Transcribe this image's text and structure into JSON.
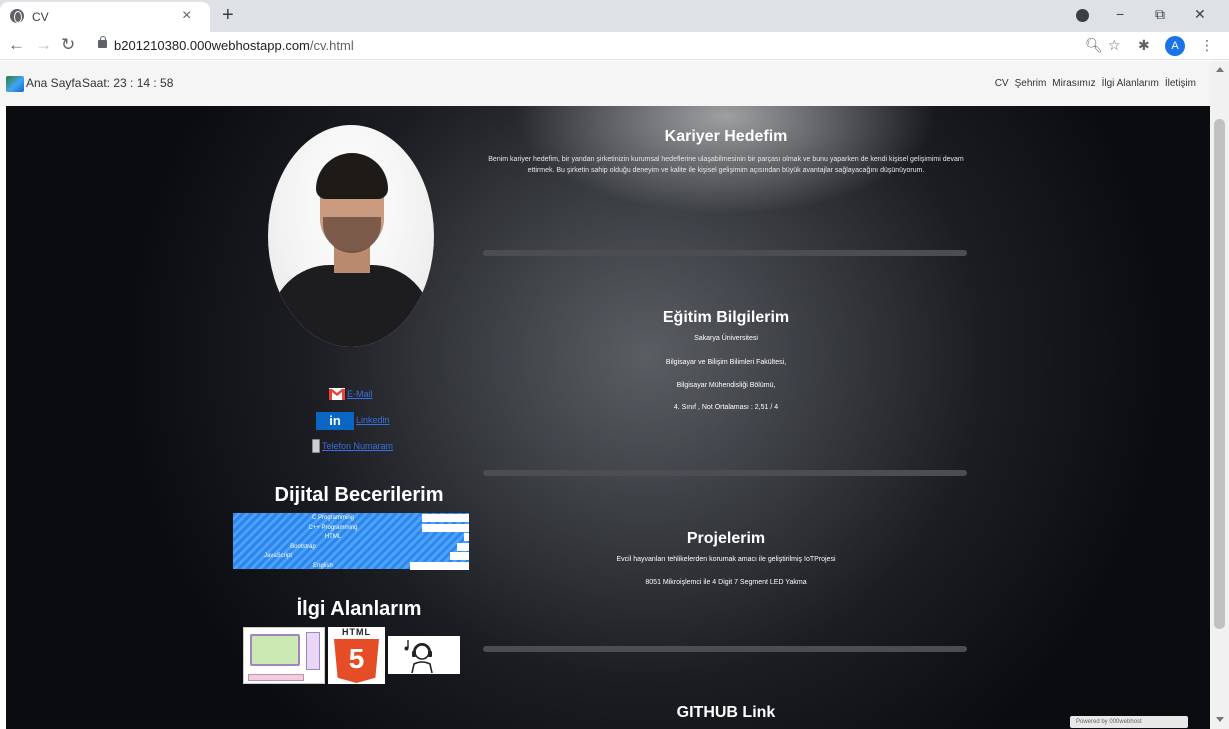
{
  "browser": {
    "tab_title": "CV",
    "new_tab": "+",
    "url_domain": "b201210380.000webhostapp.com",
    "url_path": "/cv.html",
    "profile_initial": "A",
    "controls": {
      "minimize": "−",
      "restore": "⧉",
      "close": "✕"
    }
  },
  "navbar": {
    "brand": "Ana Sayfa",
    "clock": "Saat: 23 : 14 : 58",
    "links": [
      "CV",
      "Şehrim",
      "Mirasımız",
      "İlgi Alanlarım",
      "İletişim"
    ]
  },
  "contacts": {
    "email": "E-Mail",
    "linkedin_logo": "in",
    "linkedin": "Linkedin",
    "phone": "Telefon Numaram"
  },
  "skills": {
    "heading": "Dijital Becerilerim",
    "items": [
      {
        "label": "C Programming",
        "level": 0.8
      },
      {
        "label": "C++ Programming",
        "level": 0.8
      },
      {
        "label": "HTML",
        "level": 0.98
      },
      {
        "label": "Bootstrap",
        "level": 0.95
      },
      {
        "label": "JavaScript",
        "level": 0.92
      },
      {
        "label": "English",
        "level": 0.75
      }
    ]
  },
  "interests": {
    "heading": "İlgi Alanlarım",
    "html_badge": "HTML",
    "html_number": "5"
  },
  "career": {
    "title": "Kariyer Hedefim",
    "text": "Benim kariyer hedefim, bir yandan şirketinizin kurumsal hedeflerine ulaşabilmesinin bir parçası olmak ve bunu yaparken de kendi kişisel gelişimimi devam ettirmek. Bu şirketin sahip olduğu deneyim ve kalite ile kişisel gelişimim açısından büyük avantajlar sağlayacağını düşünüyorum."
  },
  "education": {
    "title": "Eğitim Bilgilerim",
    "lines": [
      "Sakarya Üniversitesi",
      "Bilgisayar ve Bilişim Bilimleri Fakültesi,",
      "Bilgisayar Mühendisliği Bölümü,",
      "4. Sınıf , Not Ortalaması : 2,51 / 4"
    ]
  },
  "projects": {
    "title": "Projelerim",
    "lines": [
      "Evcil hayvanları tehlikelerden korumak amacı ile geliştirilmiş IoTProjesi",
      "8051 Mikroişlemci ile 4 Digit 7 Segment LED Yakma"
    ]
  },
  "github": {
    "title": "GITHUB Link"
  },
  "footer_badge": "Powered by 000webhost"
}
